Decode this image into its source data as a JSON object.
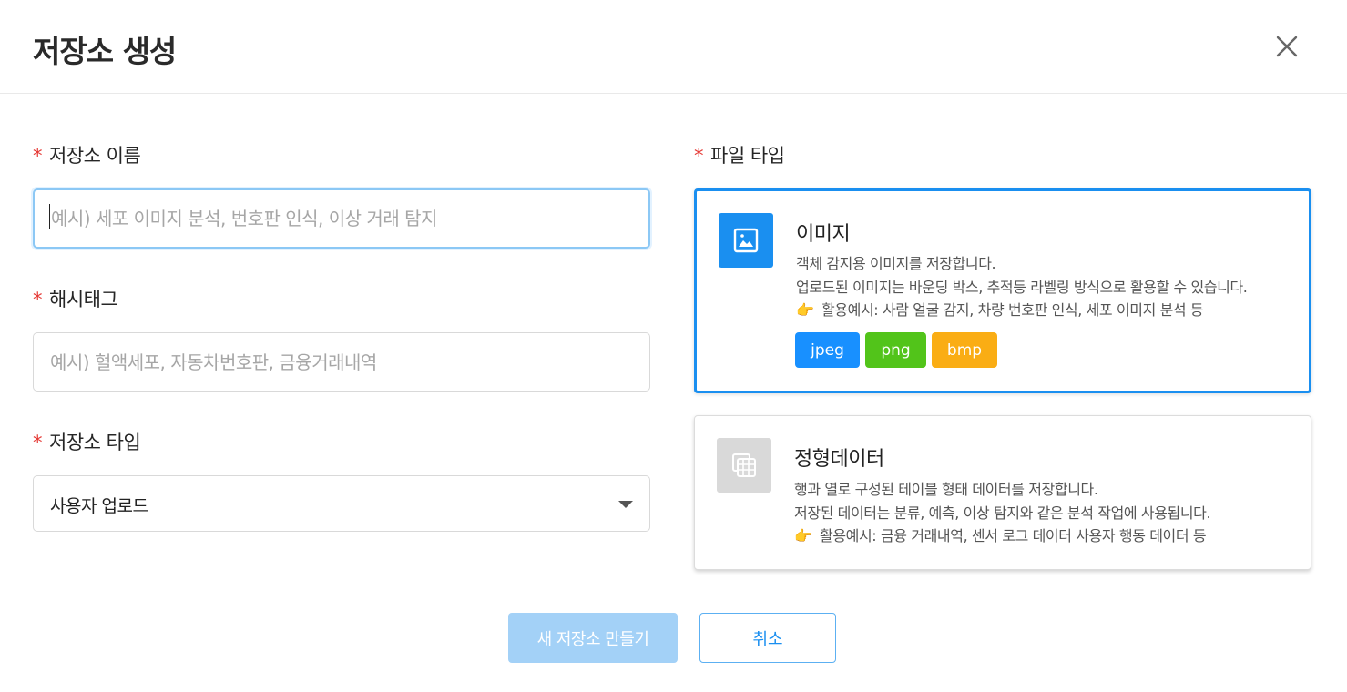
{
  "dialog": {
    "title": "저장소 생성",
    "close_icon": "close-icon"
  },
  "form": {
    "name": {
      "label": "저장소 이름",
      "placeholder": "예시) 세포 이미지 분석, 번호판 인식, 이상 거래 탐지",
      "value": ""
    },
    "hashtag": {
      "label": "해시태그",
      "placeholder": "예시) 혈액세포, 자동차번호판, 금융거래내역",
      "value": ""
    },
    "repo_type": {
      "label": "저장소 타입",
      "selected": "사용자 업로드"
    },
    "required_mark": "*"
  },
  "file_type": {
    "label": "파일 타입",
    "options": [
      {
        "title": "이미지",
        "icon": "image-icon",
        "selected": true,
        "desc": [
          "객체 감지용 이미지를 저장합니다.",
          "업로드된 이미지는 바운딩 박스, 추적등 라벨링 방식으로 활용할 수 있습니다.",
          "활용예시: 사람 얼굴 감지, 차량 번호판 인식, 세포 이미지 분석 등"
        ],
        "tags": [
          {
            "label": "jpeg",
            "color": "#1890ff"
          },
          {
            "label": "png",
            "color": "#52c41a"
          },
          {
            "label": "bmp",
            "color": "#faad14"
          }
        ]
      },
      {
        "title": "정형데이터",
        "icon": "table-data-icon",
        "selected": false,
        "desc": [
          "행과 열로 구성된 테이블 형태 데이터를 저장합니다.",
          "저장된 데이터는 분류, 예측, 이상 탐지와 같은 분석 작업에 사용됩니다.",
          "활용예시: 금융 거래내역, 센서 로그 데이터 사용자 행동 데이터 등"
        ]
      }
    ]
  },
  "actions": {
    "create_label": "새 저장소 만들기",
    "cancel_label": "취소"
  },
  "colors": {
    "accent": "#1a8ff0",
    "required": "#e53935",
    "primary_disabled": "#a3d1f7"
  }
}
